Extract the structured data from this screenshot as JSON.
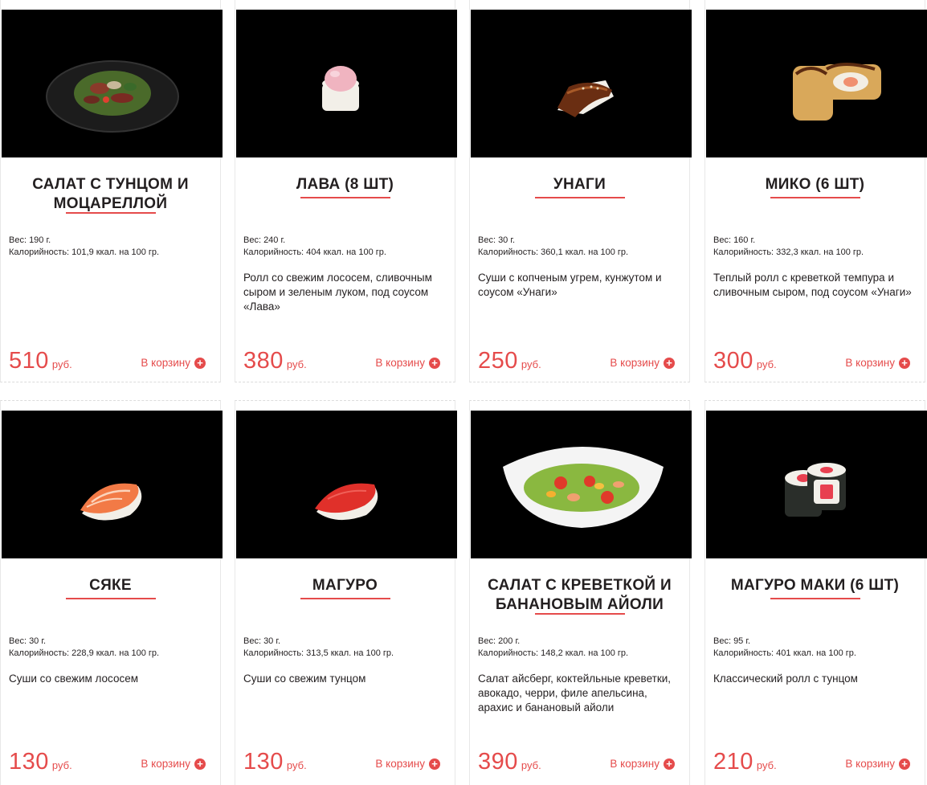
{
  "products": [
    {
      "title": "САЛАТ С ТУНЦОМ И МОЦАРЕЛЛОЙ",
      "weight": "Вес: 190 г.",
      "calories": "Калорийность: 101,9 ккал. на 100 гр.",
      "description": "",
      "price": "510",
      "currency": "руб.",
      "cart_label": "В корзину",
      "image": "tuna-salad-plate"
    },
    {
      "title": "ЛАВА (8 ШТ)",
      "weight": "Вес: 240 г.",
      "calories": "Калорийность: 404 ккал. на 100 гр.",
      "description": "Ролл со свежим лососем, сливочным сыром и зеленым луком, под соусом «Лава»",
      "price": "380",
      "currency": "руб.",
      "cart_label": "В корзину",
      "image": "lava-roll"
    },
    {
      "title": "УНАГИ",
      "weight": "Вес: 30 г.",
      "calories": "Калорийность: 360,1 ккал. на 100 гр.",
      "description": "Суши с копченым угрем, кунжутом и соусом «Унаги»",
      "price": "250",
      "currency": "руб.",
      "cart_label": "В корзину",
      "image": "unagi-sushi"
    },
    {
      "title": "МИКО (6 ШТ)",
      "weight": "Вес: 160 г.",
      "calories": "Калорийность: 332,3 ккал. на 100 гр.",
      "description": "Теплый ролл с креветкой темпура и сливочным сыром, под соусом «Унаги»",
      "price": "300",
      "currency": "руб.",
      "cart_label": "В корзину",
      "image": "miko-tempura-roll"
    },
    {
      "title": "СЯКЕ",
      "weight": "Вес: 30 г.",
      "calories": "Калорийность: 228,9 ккал. на 100 гр.",
      "description": "Суши со свежим лососем",
      "price": "130",
      "currency": "руб.",
      "cart_label": "В корзину",
      "image": "salmon-nigiri"
    },
    {
      "title": "МАГУРО",
      "weight": "Вес: 30 г.",
      "calories": "Калорийность: 313,5 ккал. на 100 гр.",
      "description": "Суши со свежим тунцом",
      "price": "130",
      "currency": "руб.",
      "cart_label": "В корзину",
      "image": "tuna-nigiri"
    },
    {
      "title": "САЛАТ С КРЕВЕТКОЙ И БАНАНОВЫМ АЙОЛИ",
      "weight": "Вес: 200 г.",
      "calories": "Калорийность: 148,2 ккал. на 100 гр.",
      "description": "Салат айсберг, коктейльные креветки, авокадо, черри, филе апельсина, арахис и банановый айоли",
      "price": "390",
      "currency": "руб.",
      "cart_label": "В корзину",
      "image": "shrimp-salad-bowl"
    },
    {
      "title": "МАГУРО МАКИ (6 ШТ)",
      "weight": "Вес: 95 г.",
      "calories": "Калорийность: 401 ккал. на 100 гр.",
      "description": "Классический ролл с тунцом",
      "price": "210",
      "currency": "руб.",
      "cart_label": "В корзину",
      "image": "tuna-maki-roll"
    }
  ],
  "colors": {
    "accent": "#e54b4b",
    "text": "#231f20",
    "photo_bg": "#000000"
  }
}
